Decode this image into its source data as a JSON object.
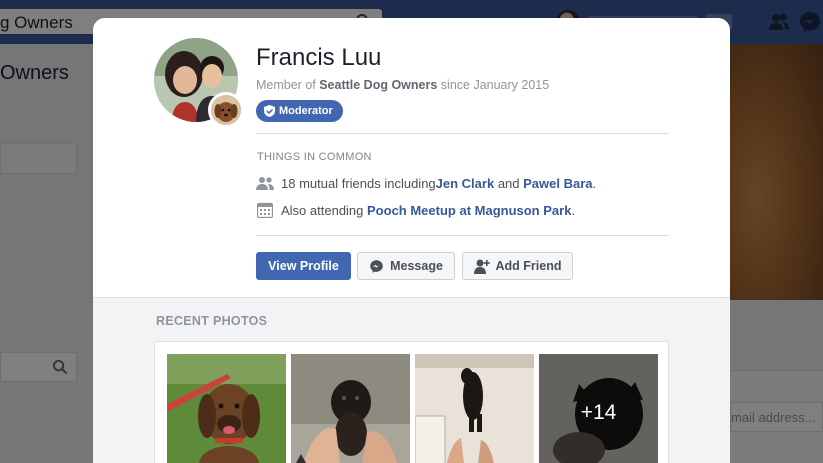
{
  "background": {
    "search_value": "g Owners",
    "group_title": "Owners",
    "email_placeholder": "mail address..."
  },
  "profile": {
    "name": "Francis Luu",
    "member_prefix": "Member of ",
    "group_name": "Seattle Dog Owners",
    "member_suffix": " since January 2015",
    "badge_label": "Moderator"
  },
  "common": {
    "section_title": "THINGS IN COMMON",
    "friends": {
      "prefix": "18 mutual friends including ",
      "friend1": "Jen Clark",
      "joiner": " and ",
      "friend2": "Pawel Bara",
      "suffix": "."
    },
    "event": {
      "prefix": "Also attending ",
      "event_name": "Pooch Meetup at Magnuson Park",
      "suffix": "."
    }
  },
  "actions": {
    "view_profile": "View Profile",
    "message": "Message",
    "add_friend": "Add Friend"
  },
  "photos": {
    "section_title": "RECENT PHOTOS",
    "more_count": "+14"
  },
  "colors": {
    "brand": "#4267b2",
    "link": "#385898",
    "topbar": "#3b5998"
  },
  "icons": [
    "search-icon",
    "friends-icon",
    "messenger-icon",
    "mutual-friends-icon",
    "calendar-icon",
    "shield-check-icon",
    "add-friend-icon"
  ]
}
